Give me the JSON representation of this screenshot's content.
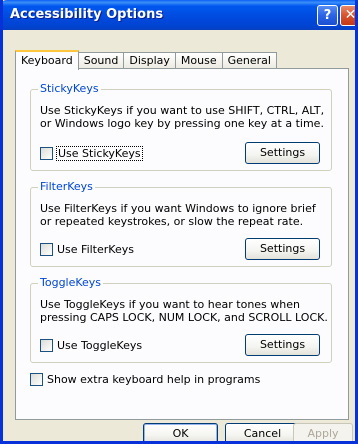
{
  "window": {
    "title": "Accessibility Options",
    "help_glyph": "?",
    "close_glyph": "✕"
  },
  "tabs": [
    {
      "label": "Keyboard",
      "active": true
    },
    {
      "label": "Sound",
      "active": false
    },
    {
      "label": "Display",
      "active": false
    },
    {
      "label": "Mouse",
      "active": false
    },
    {
      "label": "General",
      "active": false
    }
  ],
  "stickykeys": {
    "legend": "StickyKeys",
    "description": "Use StickyKeys if you want to use SHIFT, CTRL, ALT, or Windows logo key by pressing one key at a time.",
    "checkbox_label": "Use StickyKeys",
    "checked": false,
    "settings_label": "Settings"
  },
  "filterkeys": {
    "legend": "FilterKeys",
    "description": "Use FilterKeys if you want Windows to ignore brief or repeated keystrokes, or slow the repeat rate.",
    "checkbox_label": "Use FilterKeys",
    "checked": false,
    "settings_label": "Settings"
  },
  "togglekeys": {
    "legend": "ToggleKeys",
    "description": "Use ToggleKeys if you want to hear tones when pressing CAPS LOCK, NUM LOCK, and SCROLL LOCK.",
    "checkbox_label": "Use ToggleKeys",
    "checked": false,
    "settings_label": "Settings"
  },
  "extra_help": {
    "label": "Show extra keyboard help in programs",
    "checked": false
  },
  "footer": {
    "ok_label": "OK",
    "cancel_label": "Cancel",
    "apply_label": "Apply"
  },
  "colors": {
    "title_bar": "#0058ee",
    "group_legend": "#0046d5",
    "dialog_bg": "#ece9d8",
    "active_tab_accent": "#ffc83c"
  },
  "icons": {
    "help": "help-icon",
    "close": "close-icon"
  }
}
